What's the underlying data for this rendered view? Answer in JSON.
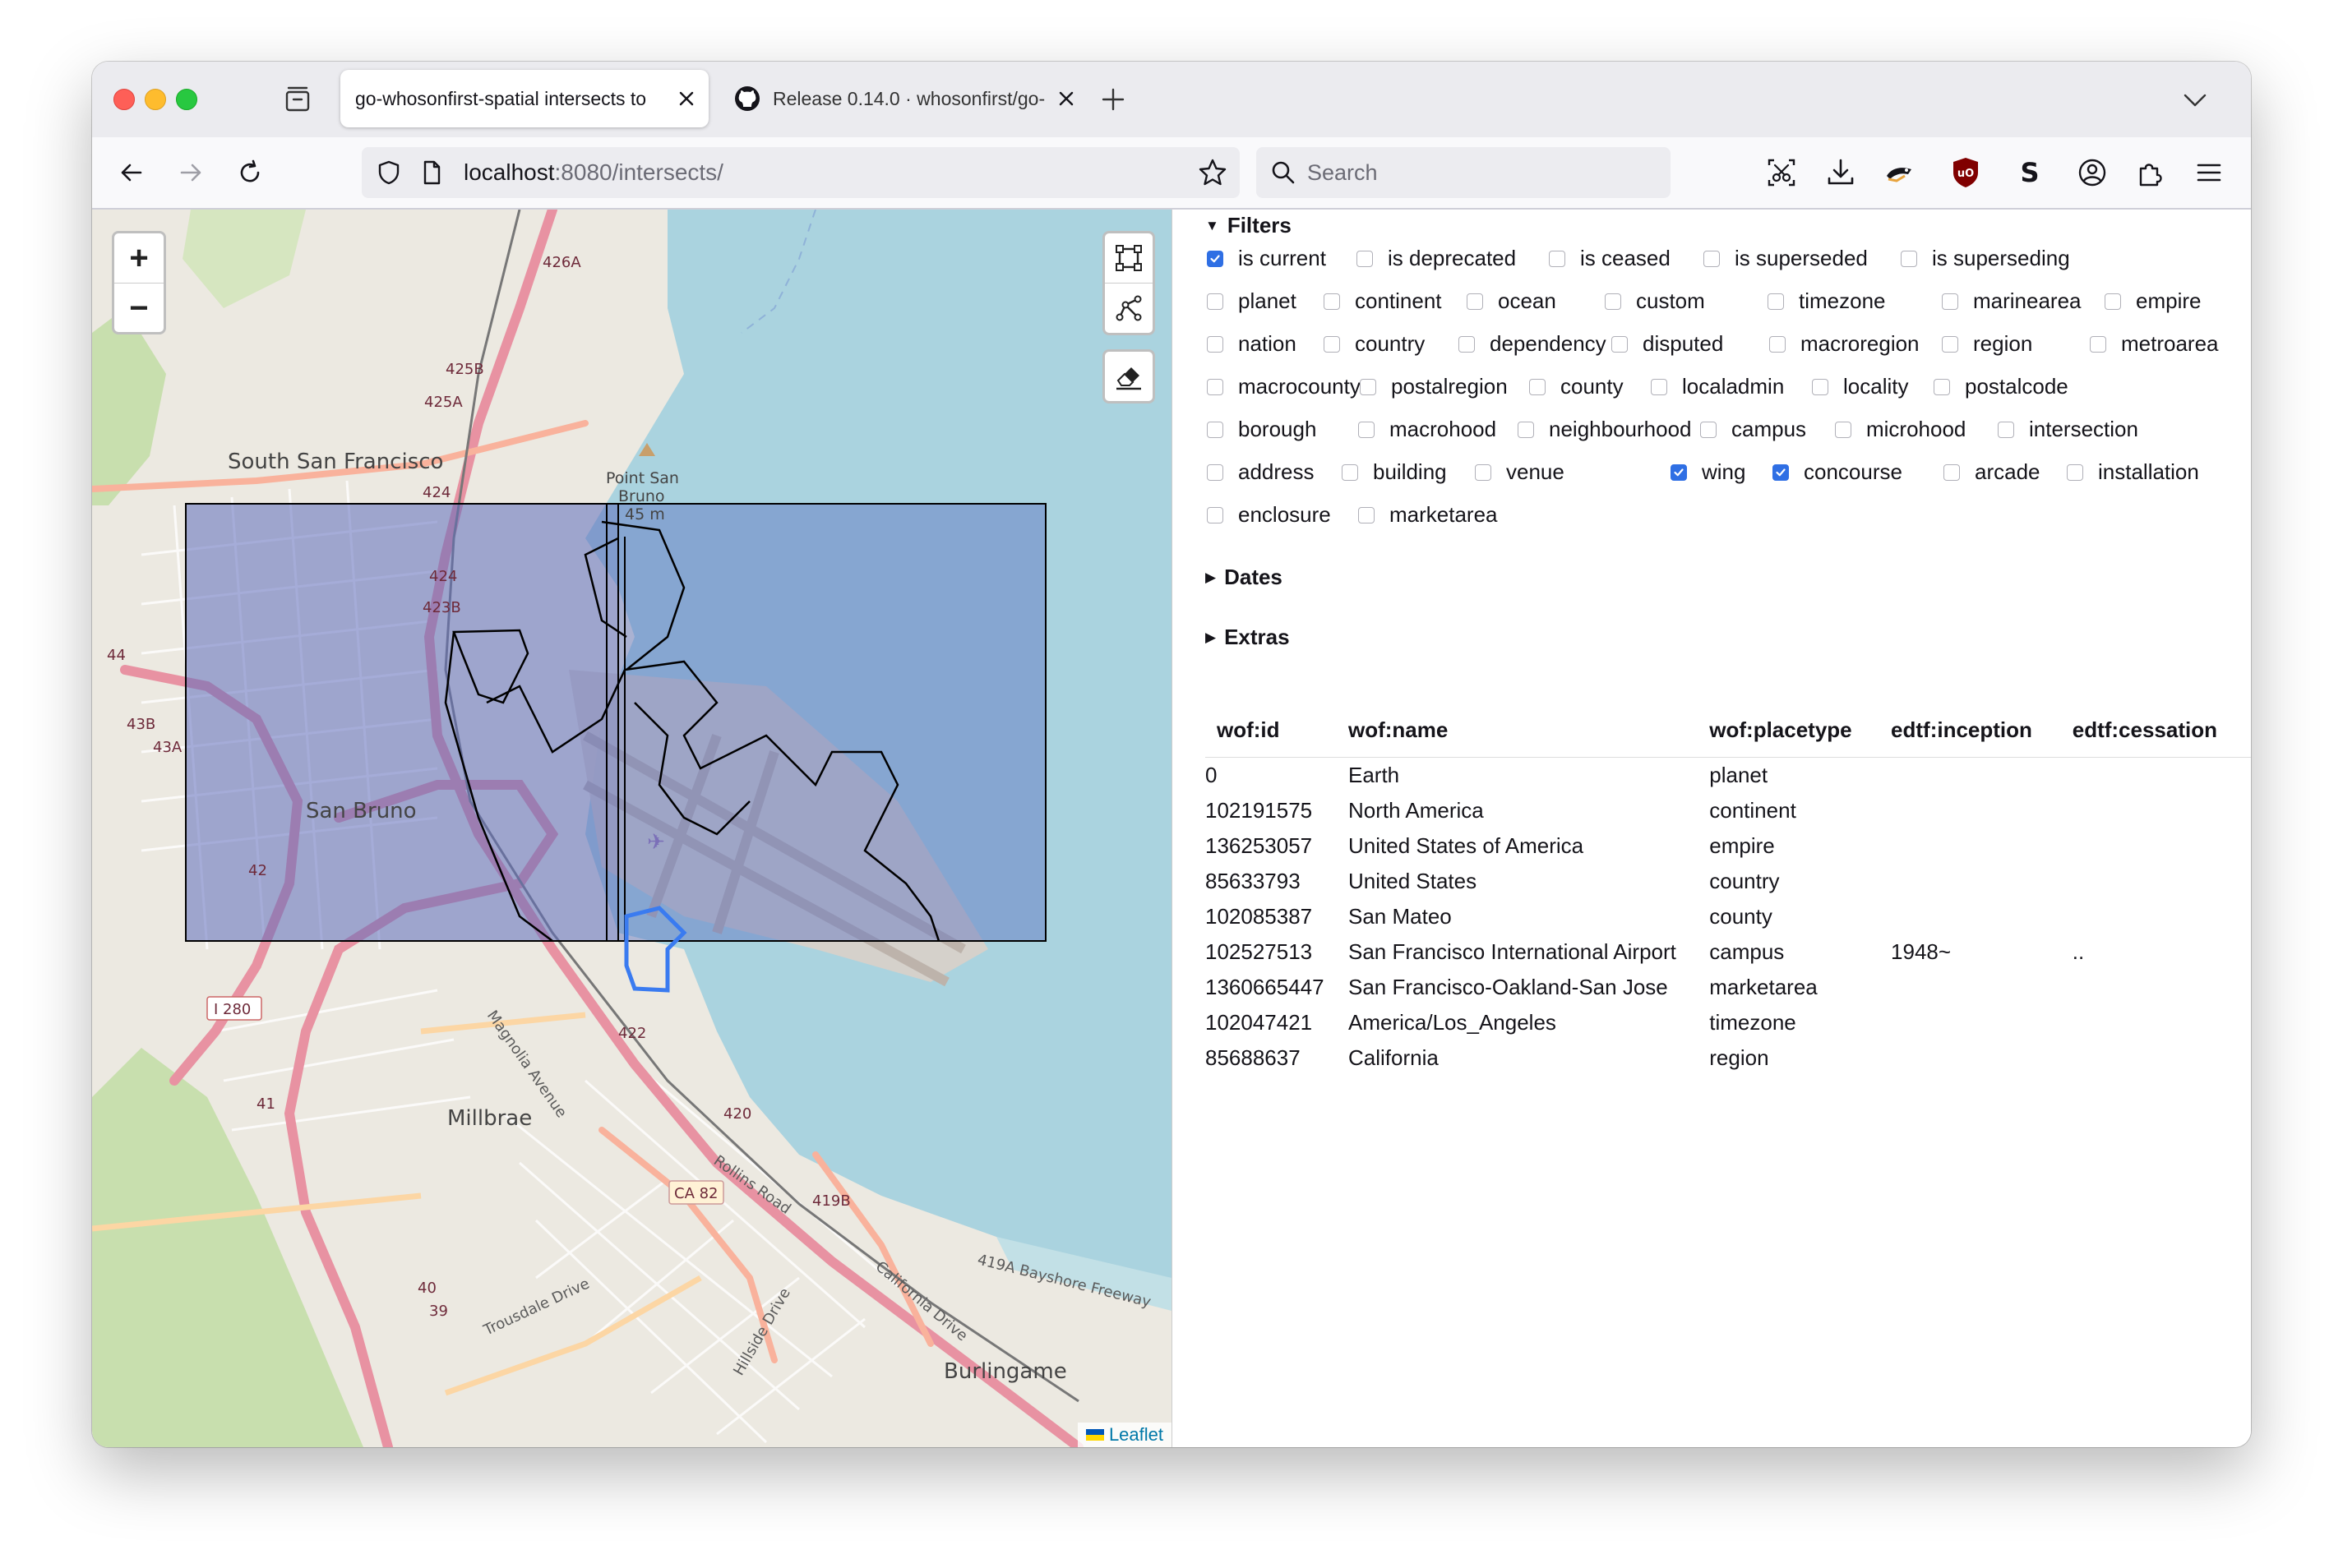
{
  "tabs": [
    {
      "title": "go-whosonfirst-spatial intersects to",
      "active": true
    },
    {
      "title": "Release 0.14.0 · whosonfirst/go-",
      "active": false
    }
  ],
  "url": {
    "host": "localhost",
    "rest": ":8080/intersects/"
  },
  "search": {
    "placeholder": "Search"
  },
  "map": {
    "zoom_in": "+",
    "zoom_out": "−",
    "attribution": "Leaflet",
    "labels": {
      "south_sf": "South San Francisco",
      "san_bruno": "San Bruno",
      "millbrae": "Millbrae",
      "burlingame": "Burlingame",
      "point_san_bruno": "Point San",
      "point_san_bruno2": "Bruno",
      "elev": "45 m",
      "i280": "I 280",
      "ca82": "CA 82",
      "rollins": "Rollins Road",
      "magnolia": "Magnolia Avenue",
      "bayshore": "419A Bayshore Freeway",
      "california": "California Drive",
      "trousdale": "Trousdale Drive",
      "hillside": "Hillside Drive",
      "r424": "424",
      "r423b": "423B",
      "r425b": "425B",
      "r425a": "425A",
      "r426a": "426A",
      "r422": "422",
      "r420": "420",
      "r419b": "419B",
      "r41": "41",
      "r43b": "43B",
      "r43a": "43A",
      "r42": "42",
      "r40": "40",
      "r39": "39",
      "r44": "44"
    }
  },
  "filters": {
    "summary": "Filters",
    "rows": [
      [
        {
          "label": "is current",
          "checked": true
        },
        {
          "label": "is deprecated",
          "checked": false
        },
        {
          "label": "is ceased",
          "checked": false
        },
        {
          "label": "is superseded",
          "checked": false
        },
        {
          "label": "is superseding",
          "checked": false
        }
      ],
      [
        {
          "label": "planet",
          "checked": false
        },
        {
          "label": "continent",
          "checked": false
        },
        {
          "label": "ocean",
          "checked": false
        },
        {
          "label": "custom",
          "checked": false
        },
        {
          "label": "timezone",
          "checked": false
        },
        {
          "label": "marinearea",
          "checked": false
        },
        {
          "label": "empire",
          "checked": false
        }
      ],
      [
        {
          "label": "nation",
          "checked": false
        },
        {
          "label": "country",
          "checked": false
        },
        {
          "label": "dependency",
          "checked": false
        },
        {
          "label": "disputed",
          "checked": false
        },
        {
          "label": "macroregion",
          "checked": false
        },
        {
          "label": "region",
          "checked": false
        },
        {
          "label": "metroarea",
          "checked": false
        }
      ],
      [
        {
          "label": "macrocounty",
          "checked": false
        },
        {
          "label": "postalregion",
          "checked": false
        },
        {
          "label": "county",
          "checked": false
        },
        {
          "label": "localadmin",
          "checked": false
        },
        {
          "label": "locality",
          "checked": false
        },
        {
          "label": "postalcode",
          "checked": false
        }
      ],
      [
        {
          "label": "borough",
          "checked": false
        },
        {
          "label": "macrohood",
          "checked": false
        },
        {
          "label": "neighbourhood",
          "checked": false
        },
        {
          "label": "campus",
          "checked": false
        },
        {
          "label": "microhood",
          "checked": false
        },
        {
          "label": "intersection",
          "checked": false
        }
      ],
      [
        {
          "label": "address",
          "checked": false
        },
        {
          "label": "building",
          "checked": false
        },
        {
          "label": "venue",
          "checked": false
        },
        {
          "label": "wing",
          "checked": true
        },
        {
          "label": "concourse",
          "checked": true
        },
        {
          "label": "arcade",
          "checked": false
        },
        {
          "label": "installation",
          "checked": false
        }
      ],
      [
        {
          "label": "enclosure",
          "checked": false
        },
        {
          "label": "marketarea",
          "checked": false
        }
      ]
    ]
  },
  "dates": {
    "summary": "Dates"
  },
  "extras": {
    "summary": "Extras"
  },
  "results": {
    "headers": [
      "wof:id",
      "wof:name",
      "wof:placetype",
      "edtf:inception",
      "edtf:cessation"
    ],
    "rows": [
      [
        "0",
        "Earth",
        "planet",
        "",
        ""
      ],
      [
        "102191575",
        "North America",
        "continent",
        "",
        ""
      ],
      [
        "136253057",
        "United States of America",
        "empire",
        "",
        ""
      ],
      [
        "85633793",
        "United States",
        "country",
        "",
        ""
      ],
      [
        "102085387",
        "San Mateo",
        "county",
        "",
        ""
      ],
      [
        "102527513",
        "San Francisco International Airport",
        "campus",
        "1948~",
        ".."
      ],
      [
        "1360665447",
        "San Francisco-Oakland-San Jose",
        "marketarea",
        "",
        ""
      ],
      [
        "102047421",
        "America/Los_Angeles",
        "timezone",
        "",
        ""
      ],
      [
        "85688637",
        "California",
        "region",
        "",
        ""
      ]
    ]
  }
}
